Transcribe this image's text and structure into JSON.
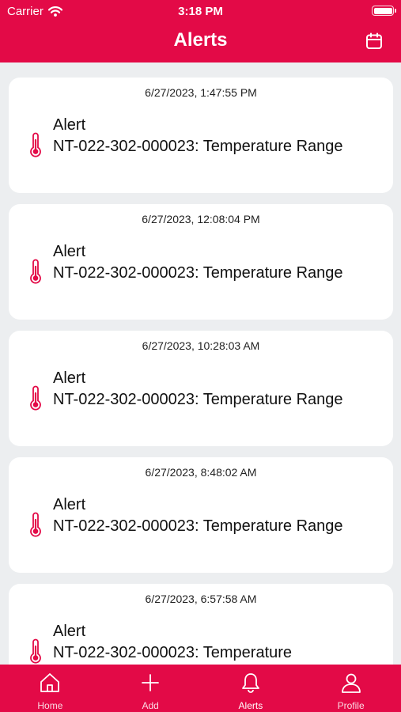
{
  "status_bar": {
    "carrier": "Carrier",
    "time": "3:18 PM"
  },
  "nav": {
    "title": "Alerts",
    "calendar_icon": "calendar-icon"
  },
  "alerts": [
    {
      "timestamp": "6/27/2023, 1:47:55 PM",
      "type": "Alert",
      "message": "NT-022-302-000023: Temperature Range",
      "icon": "thermometer-icon"
    },
    {
      "timestamp": "6/27/2023, 12:08:04 PM",
      "type": "Alert",
      "message": "NT-022-302-000023: Temperature Range",
      "icon": "thermometer-icon"
    },
    {
      "timestamp": "6/27/2023, 10:28:03 AM",
      "type": "Alert",
      "message": "NT-022-302-000023: Temperature Range",
      "icon": "thermometer-icon"
    },
    {
      "timestamp": "6/27/2023, 8:48:02 AM",
      "type": "Alert",
      "message": "NT-022-302-000023: Temperature Range",
      "icon": "thermometer-icon"
    },
    {
      "timestamp": "6/27/2023, 6:57:58 AM",
      "type": "Alert",
      "message": "NT-022-302-000023: Temperature",
      "icon": "thermometer-icon"
    }
  ],
  "tabs": [
    {
      "label": "Home",
      "icon": "home-icon"
    },
    {
      "label": "Add",
      "icon": "plus-icon"
    },
    {
      "label": "Alerts",
      "icon": "bell-icon",
      "active": true
    },
    {
      "label": "Profile",
      "icon": "person-icon"
    }
  ],
  "colors": {
    "accent": "#e30a47",
    "background": "#eceef0",
    "card": "#ffffff"
  }
}
